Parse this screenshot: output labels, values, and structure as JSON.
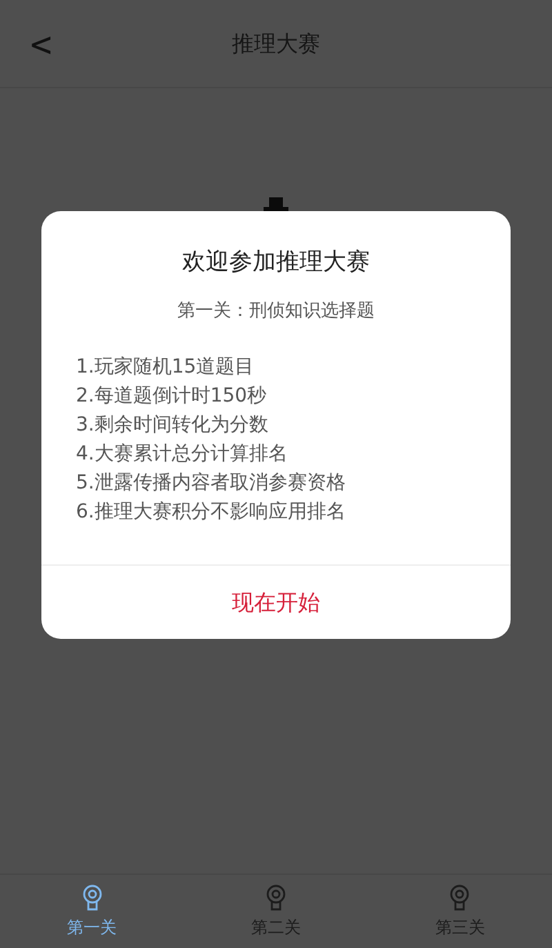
{
  "header": {
    "back": "<",
    "title": "推理大赛"
  },
  "dialog": {
    "title": "欢迎参加推理大赛",
    "subtitle": "第一关：刑侦知识选择题",
    "rules": [
      "1.玩家随机15道题目",
      "2.每道题倒计时150秒",
      "3.剩余时间转化为分数",
      "4.大赛累计总分计算排名",
      "5.泄露传播内容者取消参赛资格",
      "6.推理大赛积分不影响应用排名"
    ],
    "button": "现在开始"
  },
  "tabs": [
    {
      "label": "第一关",
      "selected": true
    },
    {
      "label": "第二关",
      "selected": false
    },
    {
      "label": "第三关",
      "selected": false
    }
  ]
}
